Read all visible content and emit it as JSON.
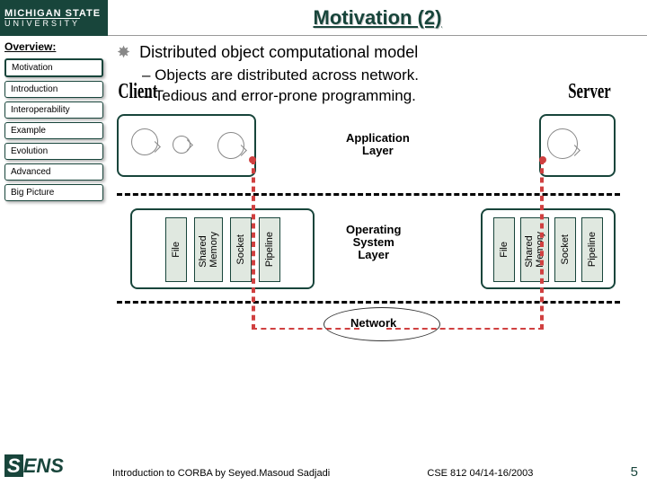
{
  "logo": {
    "top": "MICHIGAN STATE",
    "bottom": "UNIVERSITY"
  },
  "title": "Motivation (2)",
  "sidebar": {
    "label": "Overview:",
    "items": [
      "Motivation",
      "Introduction",
      "Interoperability",
      "Example",
      "Evolution",
      "Advanced",
      "Big Picture"
    ]
  },
  "sens": {
    "s": "S",
    "rest": "ENS"
  },
  "body": {
    "bullet": "Distributed object computational model",
    "subs": [
      "– Objects are distributed across network.",
      "– Tedious and error-prone programming."
    ]
  },
  "diagram": {
    "client": "Client",
    "server": "Server",
    "app_layer": "Application\nLayer",
    "os_layer": "Operating\nSystem\nLayer",
    "network": "Network",
    "bars": {
      "file": "File",
      "shared": "Shared\nMemory",
      "socket": "Socket",
      "pipeline": "Pipeline"
    }
  },
  "footer": {
    "left": "Introduction to CORBA by Seyed.Masoud Sadjadi",
    "right": "CSE 812   04/14-16/2003",
    "page": "5"
  }
}
